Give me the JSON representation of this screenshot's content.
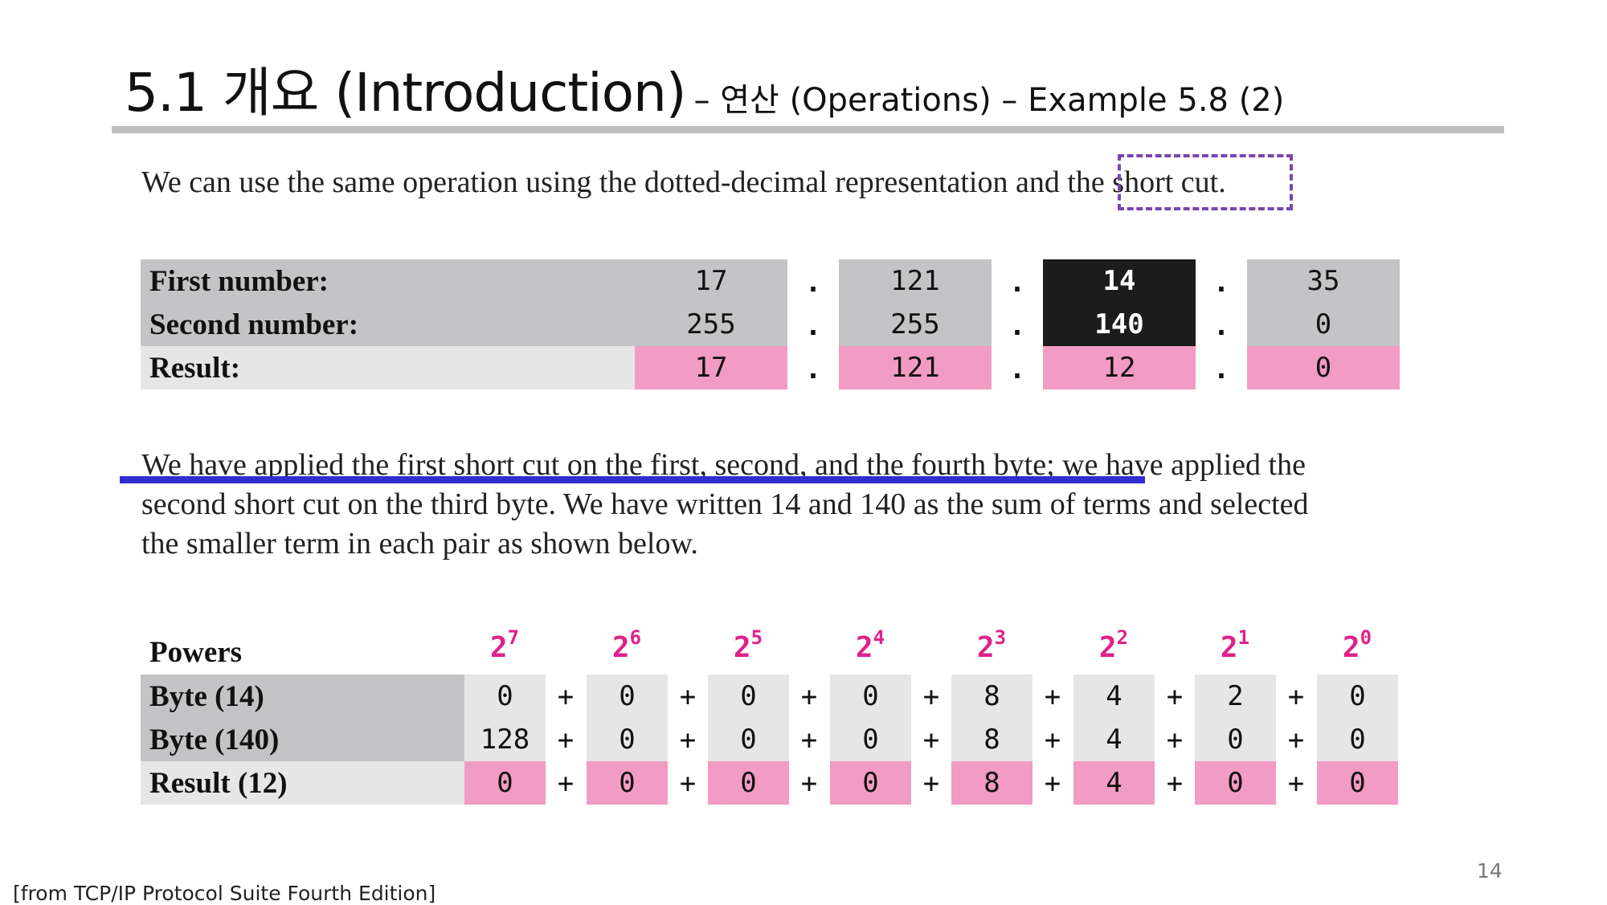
{
  "slide": {
    "title_main": "5.1 개요 (Introduction)",
    "title_sub": "– 연산 (Operations) – Example 5.8 (2)",
    "intro_before": "We can use the same operation using the dotted-decimal representation and ",
    "intro_boxed": "the short cut.",
    "paragraph_lines": [
      "We have applied the first short cut on the first, second, and the fourth byte; we have applied the",
      "second short cut on the third byte. We have written 14 and 140 as the sum of terms and selected",
      "the smaller term in each pair as shown below."
    ],
    "source": "[from TCP/IP Protocol Suite Fourth Edition]",
    "page_number": "14"
  },
  "table1": {
    "labels": [
      "First number:",
      "Second number:",
      "Result:"
    ],
    "first": [
      "17",
      "121",
      "14",
      "35"
    ],
    "second": [
      "255",
      "255",
      "140",
      "0"
    ],
    "result": [
      "17",
      "121",
      "12",
      "0"
    ],
    "separator": "."
  },
  "table2": {
    "header_label": "Powers",
    "powers_base": "2",
    "powers_exp": [
      "7",
      "6",
      "5",
      "4",
      "3",
      "2",
      "1",
      "0"
    ],
    "labels": [
      "Byte (14)",
      "Byte (140)",
      "Result (12)"
    ],
    "byte14": [
      "0",
      "0",
      "0",
      "0",
      "8",
      "4",
      "2",
      "0"
    ],
    "byte140": [
      "128",
      "0",
      "0",
      "0",
      "8",
      "4",
      "0",
      "0"
    ],
    "result": [
      "0",
      "0",
      "0",
      "0",
      "8",
      "4",
      "0",
      "0"
    ],
    "plus": "+"
  },
  "colors": {
    "highlight_pink": "#f29bc4",
    "powers_magenta": "#e0218a",
    "dashed_box_purple": "#7b45b0",
    "underline_blue": "#2f2fd0"
  }
}
